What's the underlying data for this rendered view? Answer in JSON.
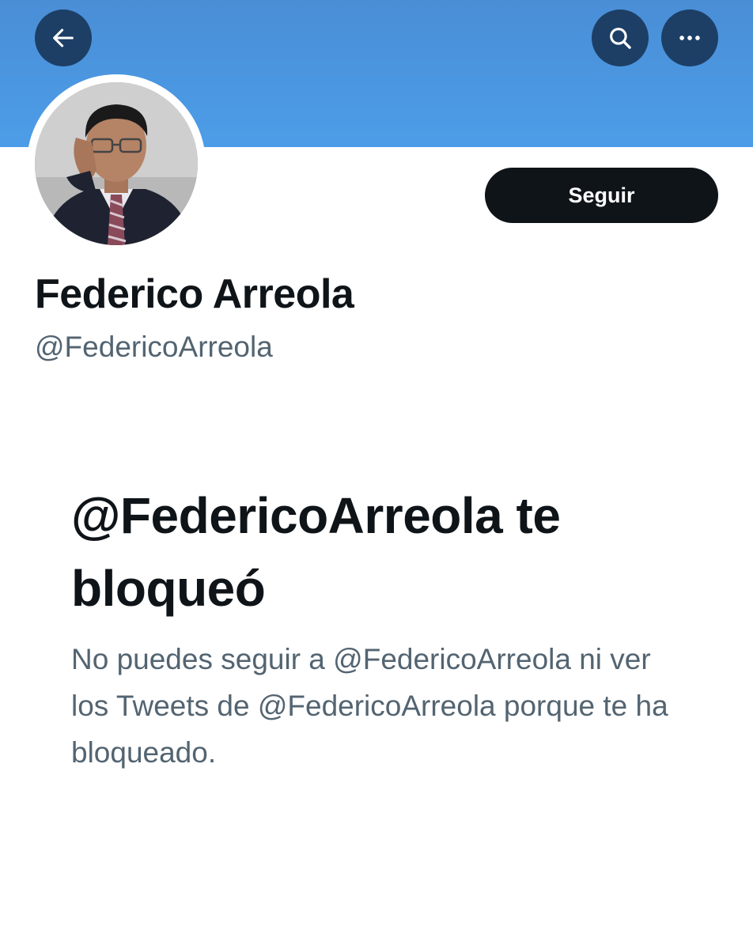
{
  "header": {
    "back_icon": "arrow-left-icon",
    "search_icon": "search-icon",
    "more_icon": "more-horizontal-icon",
    "banner_color": "#4a90e2",
    "button_color": "#1d3f66"
  },
  "profile": {
    "avatar": "profile-photo",
    "display_name": "Federico Arreola",
    "handle": "@FedericoArreola",
    "follow_label": "Seguir"
  },
  "blocked": {
    "title": "@FedericoArreola te bloqueó",
    "description": "No puedes seguir a @FedericoArreola ni ver los Tweets de @FedericoArreola porque te ha bloqueado."
  }
}
